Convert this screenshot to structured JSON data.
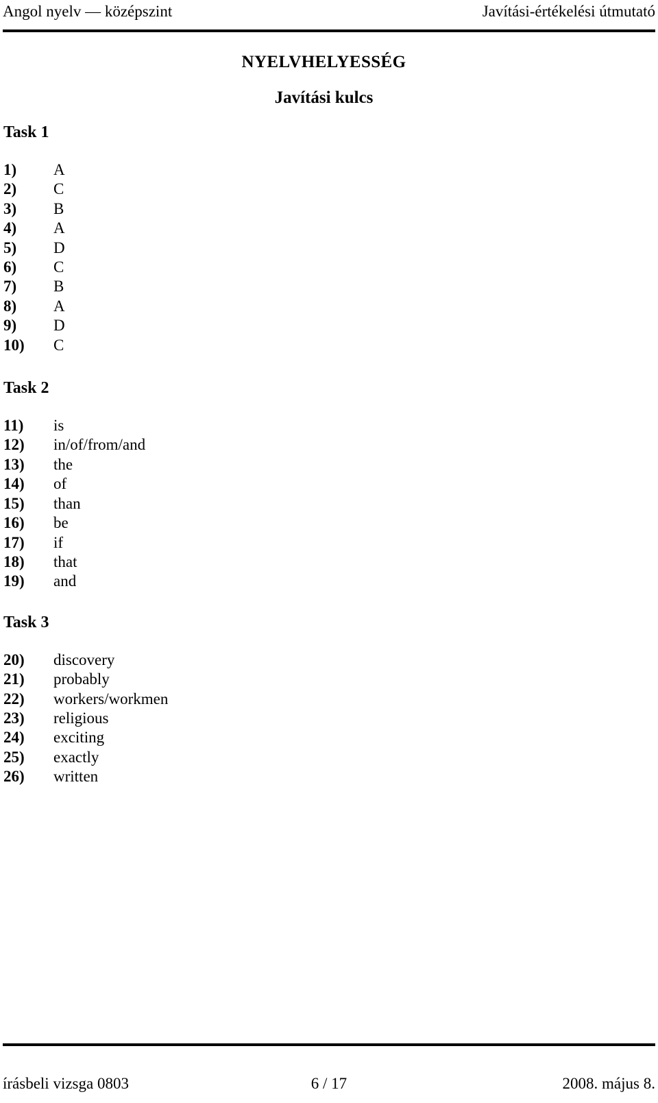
{
  "header": {
    "left": "Angol nyelv — középszint",
    "right": "Javítási-értékelési útmutató"
  },
  "title": {
    "main": "NYELVHELYESSÉG",
    "sub": "Javítási kulcs"
  },
  "tasks": [
    {
      "heading": "Task 1",
      "answers": [
        {
          "num": "1)",
          "value": "A"
        },
        {
          "num": "2)",
          "value": "C"
        },
        {
          "num": "3)",
          "value": "B"
        },
        {
          "num": "4)",
          "value": "A"
        },
        {
          "num": "5)",
          "value": "D"
        },
        {
          "num": "6)",
          "value": "C"
        },
        {
          "num": "7)",
          "value": "B"
        },
        {
          "num": "8)",
          "value": "A"
        },
        {
          "num": "9)",
          "value": "D"
        },
        {
          "num": "10)",
          "value": "C"
        }
      ]
    },
    {
      "heading": "Task 2",
      "answers": [
        {
          "num": "11)",
          "value": "is"
        },
        {
          "num": "12)",
          "value": "in/of/from/and"
        },
        {
          "num": "13)",
          "value": "the"
        },
        {
          "num": "14)",
          "value": "of"
        },
        {
          "num": "15)",
          "value": "than"
        },
        {
          "num": "16)",
          "value": "be"
        },
        {
          "num": "17)",
          "value": "if"
        },
        {
          "num": "18)",
          "value": "that"
        },
        {
          "num": "19)",
          "value": "and"
        }
      ]
    },
    {
      "heading": "Task 3",
      "answers": [
        {
          "num": "20)",
          "value": "discovery"
        },
        {
          "num": "21)",
          "value": "probably"
        },
        {
          "num": "22)",
          "value": "workers/workmen"
        },
        {
          "num": "23)",
          "value": "religious"
        },
        {
          "num": "24)",
          "value": "exciting"
        },
        {
          "num": "25)",
          "value": "exactly"
        },
        {
          "num": "26)",
          "value": "written"
        }
      ]
    }
  ],
  "footer": {
    "left": "írásbeli vizsga 0803",
    "center": "6 / 17",
    "right": "2008. május 8."
  }
}
